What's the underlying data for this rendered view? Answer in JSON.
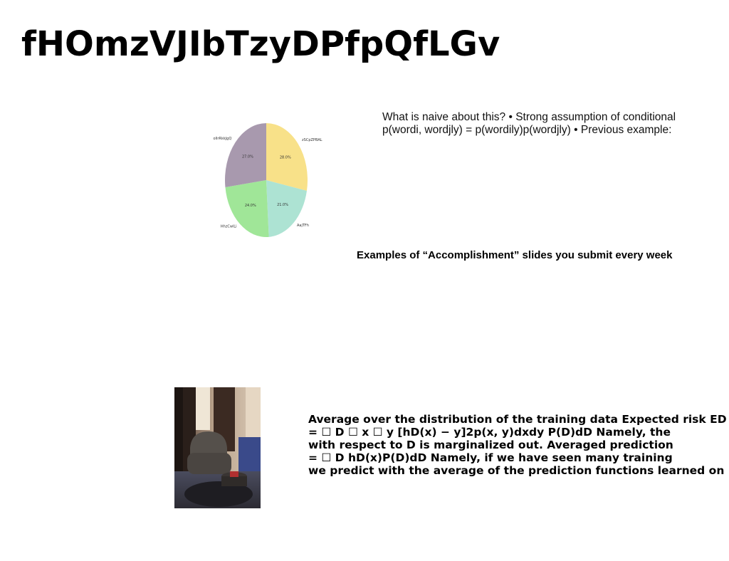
{
  "slide": {
    "title": "fHOmzVJIbTzyDPfpQfLGv",
    "naive_text": "What is naive about this? • Strong assumption of conditional p(wordi, wordjly) = p(wordily)p(wordjly) • Previous example:",
    "accomplishment_text": "Examples of “Accomplishment” slides you submit every week",
    "risk_lines": [
      "Average over the distribution of the training data Expected risk ED",
      "= ☐ D ☐ x ☐ y [hD(x) − y]2p(x, y)dxdy P(D)dD Namely, the",
      "with respect to D is marginalized out. Averaged prediction",
      "= ☐ D hD(x)P(D)dD Namely, if we have seen many training",
      "we predict with the average of the prediction functions learned on"
    ]
  },
  "chart_data": {
    "type": "pie",
    "labels": [
      "zSCpZPBAL",
      "AajTFh",
      "HhzCwlLi",
      "oIlrRkkJgQ"
    ],
    "values": [
      28.0,
      21.0,
      24.0,
      27.0
    ],
    "value_labels": [
      "28.0%",
      "21.0%",
      "24.0%",
      "27.0%"
    ],
    "colors": [
      "#f8e189",
      "#ade3d3",
      "#a0e698",
      "#a899ae"
    ],
    "start_angle_deg": 90,
    "direction": "clockwise"
  }
}
